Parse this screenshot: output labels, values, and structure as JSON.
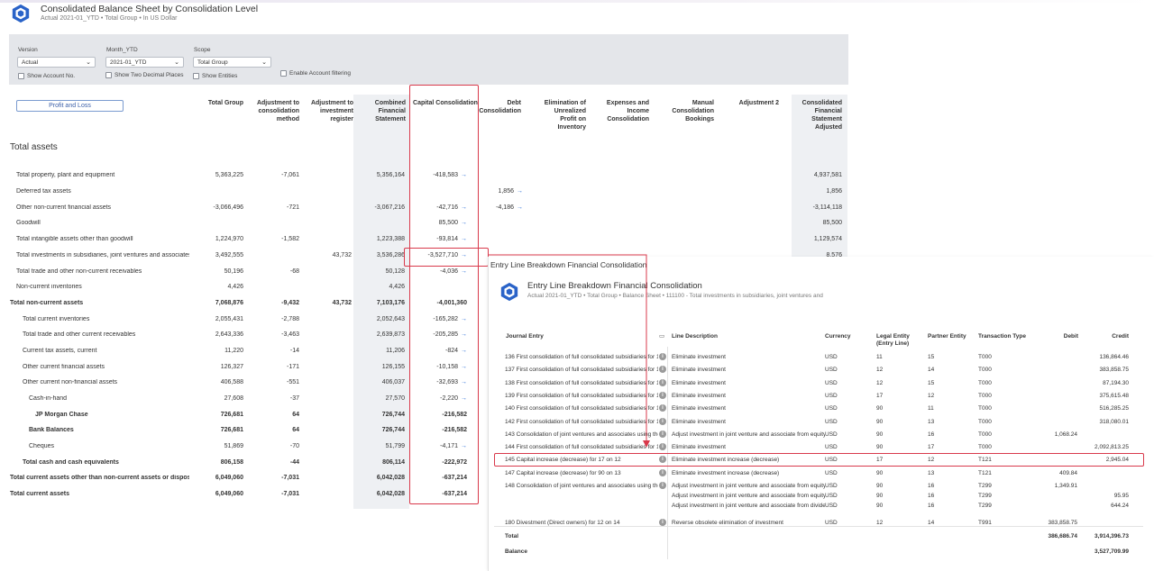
{
  "header": {
    "title": "Consolidated Balance Sheet by Consolidation Level",
    "subtitle": "Actual 2021-01_YTD • Total Group • In US Dollar"
  },
  "filters": {
    "version_label": "Version",
    "version_value": "Actual",
    "month_label": "Month_YTD",
    "month_value": "2021-01_YTD",
    "scope_label": "Scope",
    "scope_value": "Total Group",
    "show_account_no": "Show Account No.",
    "show_two_decimals": "Show Two Decimal Places",
    "show_entities": "Show Entities",
    "enable_account_filtering": "Enable Account filtering"
  },
  "pl_button": "Profit and Loss",
  "columns": [
    "Total Group",
    "Adjustment to consolidation method",
    "Adjustment to investment register",
    "Combined Financial Statement",
    "Capital Consolidation",
    "Debt Consolidation",
    "Elimination of Unrealized Profit on Inventory",
    "Expenses and Income Consolidation",
    "Manual Consolidation Bookings",
    "Adjustment 2",
    "Consolidated Financial Statement Adjusted"
  ],
  "section_title": "Total assets",
  "rows": [
    {
      "label": "Total property, plant and equipment",
      "indent": 0,
      "bold": false,
      "tg": "5,363,225",
      "acm": "-7,061",
      "air": "",
      "cfs": "5,356,164",
      "cc": "-418,583",
      "cc_arrow": true,
      "dc": "",
      "dc_arrow": false,
      "cfsa": "4,937,581"
    },
    {
      "label": "Deferred tax assets",
      "indent": 0,
      "bold": false,
      "tg": "",
      "acm": "",
      "air": "",
      "cfs": "",
      "cc": "",
      "cc_arrow": false,
      "dc": "1,856",
      "dc_arrow": true,
      "cfsa": "1,856"
    },
    {
      "label": "Other non-current financial assets",
      "indent": 0,
      "bold": false,
      "tg": "-3,066,496",
      "acm": "-721",
      "air": "",
      "cfs": "-3,067,216",
      "cc": "-42,716",
      "cc_arrow": true,
      "dc": "-4,186",
      "dc_arrow": true,
      "cfsa": "-3,114,118"
    },
    {
      "label": "Goodwill",
      "indent": 0,
      "bold": false,
      "tg": "",
      "acm": "",
      "air": "",
      "cfs": "",
      "cc": "85,500",
      "cc_arrow": true,
      "dc": "",
      "dc_arrow": false,
      "cfsa": "85,500"
    },
    {
      "label": "Total intangible assets other than goodwill",
      "indent": 0,
      "bold": false,
      "tg": "1,224,970",
      "acm": "-1,582",
      "air": "",
      "cfs": "1,223,388",
      "cc": "-93,814",
      "cc_arrow": true,
      "dc": "",
      "dc_arrow": false,
      "cfsa": "1,129,574"
    },
    {
      "label": "Total investments in subsidiaries, joint ventures and associates",
      "indent": 0,
      "bold": false,
      "tg": "3,492,555",
      "acm": "",
      "air": "43,732",
      "cfs": "3,536,286",
      "cc": "-3,527,710",
      "cc_arrow": true,
      "dc": "",
      "dc_arrow": false,
      "cfsa": "8,576"
    },
    {
      "label": "Total trade and other non-current receivables",
      "indent": 0,
      "bold": false,
      "tg": "50,196",
      "acm": "-68",
      "air": "",
      "cfs": "50,128",
      "cc": "-4,036",
      "cc_arrow": true,
      "dc": "",
      "dc_arrow": false,
      "cfsa": ""
    },
    {
      "label": "Non-current inventories",
      "indent": 0,
      "bold": false,
      "tg": "4,426",
      "acm": "",
      "air": "",
      "cfs": "4,426",
      "cc": "",
      "cc_arrow": false,
      "dc": "",
      "dc_arrow": false,
      "cfsa": ""
    },
    {
      "label": "Total non-current assets",
      "indent": -1,
      "bold": true,
      "tg": "7,068,876",
      "acm": "-9,432",
      "air": "43,732",
      "cfs": "7,103,176",
      "cc": "-4,001,360",
      "cc_arrow": false,
      "dc": "",
      "dc_arrow": false,
      "cfsa": ""
    },
    {
      "label": "Total current inventories",
      "indent": 1,
      "bold": false,
      "tg": "2,055,431",
      "acm": "-2,788",
      "air": "",
      "cfs": "2,052,643",
      "cc": "-165,282",
      "cc_arrow": true,
      "dc": "",
      "dc_arrow": false,
      "cfsa": ""
    },
    {
      "label": "Total trade and other current receivables",
      "indent": 1,
      "bold": false,
      "tg": "2,643,336",
      "acm": "-3,463",
      "air": "",
      "cfs": "2,639,873",
      "cc": "-205,285",
      "cc_arrow": true,
      "dc": "",
      "dc_arrow": false,
      "cfsa": ""
    },
    {
      "label": "Current tax assets, current",
      "indent": 1,
      "bold": false,
      "tg": "11,220",
      "acm": "-14",
      "air": "",
      "cfs": "11,206",
      "cc": "-824",
      "cc_arrow": true,
      "dc": "",
      "dc_arrow": false,
      "cfsa": ""
    },
    {
      "label": "Other current financial assets",
      "indent": 1,
      "bold": false,
      "tg": "126,327",
      "acm": "-171",
      "air": "",
      "cfs": "126,155",
      "cc": "-10,158",
      "cc_arrow": true,
      "dc": "",
      "dc_arrow": false,
      "cfsa": ""
    },
    {
      "label": "Other current non-financial assets",
      "indent": 1,
      "bold": false,
      "tg": "406,588",
      "acm": "-551",
      "air": "",
      "cfs": "406,037",
      "cc": "-32,693",
      "cc_arrow": true,
      "dc": "",
      "dc_arrow": false,
      "cfsa": ""
    },
    {
      "label": "Cash-in-hand",
      "indent": 2,
      "bold": false,
      "tg": "27,608",
      "acm": "-37",
      "air": "",
      "cfs": "27,570",
      "cc": "-2,220",
      "cc_arrow": true,
      "dc": "",
      "dc_arrow": false,
      "cfsa": ""
    },
    {
      "label": "JP Morgan Chase",
      "indent": 3,
      "bold": true,
      "tg": "726,681",
      "acm": "64",
      "air": "",
      "cfs": "726,744",
      "cc": "-216,582",
      "cc_arrow": false,
      "dc": "",
      "dc_arrow": false,
      "cfsa": ""
    },
    {
      "label": "Bank Balances",
      "indent": 2,
      "bold": true,
      "tg": "726,681",
      "acm": "64",
      "air": "",
      "cfs": "726,744",
      "cc": "-216,582",
      "cc_arrow": false,
      "dc": "",
      "dc_arrow": false,
      "cfsa": ""
    },
    {
      "label": "Cheques",
      "indent": 2,
      "bold": false,
      "tg": "51,869",
      "acm": "-70",
      "air": "",
      "cfs": "51,799",
      "cc": "-4,171",
      "cc_arrow": true,
      "dc": "",
      "dc_arrow": false,
      "cfsa": ""
    },
    {
      "label": "Total cash and cash equivalents",
      "indent": 1,
      "bold": true,
      "tg": "806,158",
      "acm": "-44",
      "air": "",
      "cfs": "806,114",
      "cc": "-222,972",
      "cc_arrow": false,
      "dc": "",
      "dc_arrow": false,
      "cfsa": ""
    },
    {
      "label": "Total current assets other than non-current assets or disposal groups",
      "indent": -1,
      "bold": true,
      "tg": "6,049,060",
      "acm": "-7,031",
      "air": "",
      "cfs": "6,042,028",
      "cc": "-637,214",
      "cc_arrow": false,
      "dc": "",
      "dc_arrow": false,
      "cfsa": ""
    },
    {
      "label": "Total current assets",
      "indent": -1,
      "bold": true,
      "tg": "6,049,060",
      "acm": "-7,031",
      "air": "",
      "cfs": "6,042,028",
      "cc": "-637,214",
      "cc_arrow": false,
      "dc": "",
      "dc_arrow": false,
      "cfsa": ""
    }
  ],
  "popup": {
    "label": "Entry Line Breakdown Financial Consolidation",
    "title": "Entry Line Breakdown Financial Consolidation",
    "subtitle": "Actual 2021-01_YTD • Total Group • Balance Sheet • 111100 - Total investments in subsidiaries, joint ventures and",
    "columns": {
      "journal": "Journal Entry",
      "line_desc": "Line Description",
      "currency": "Currency",
      "legal": "Legal Entity (Entry Line)",
      "partner": "Partner Entity",
      "ttype": "Transaction Type",
      "debit": "Debit",
      "credit": "Credit"
    },
    "rows": [
      {
        "je": "136 First consolidation of full consolidated subsidiaries for 15 on 11",
        "info": true,
        "lines": [
          {
            "desc": "Eliminate investment",
            "cur": "USD",
            "le": "11",
            "pe": "15",
            "tt": "T000",
            "debit": "",
            "credit": "136,864.46"
          }
        ]
      },
      {
        "je": "137 First consolidation of full consolidated subsidiaries for 14 on 12",
        "info": true,
        "lines": [
          {
            "desc": "Eliminate investment",
            "cur": "USD",
            "le": "12",
            "pe": "14",
            "tt": "T000",
            "debit": "",
            "credit": "383,858.75"
          }
        ]
      },
      {
        "je": "138 First consolidation of full consolidated subsidiaries for 15 on 12",
        "info": true,
        "lines": [
          {
            "desc": "Eliminate investment",
            "cur": "USD",
            "le": "12",
            "pe": "15",
            "tt": "T000",
            "debit": "",
            "credit": "87,194.30"
          }
        ]
      },
      {
        "je": "139 First consolidation of full consolidated subsidiaries for 12 on 17",
        "info": true,
        "lines": [
          {
            "desc": "Eliminate investment",
            "cur": "USD",
            "le": "17",
            "pe": "12",
            "tt": "T000",
            "debit": "",
            "credit": "375,615.48"
          }
        ]
      },
      {
        "je": "140 First consolidation of full consolidated subsidiaries for 11 on 90",
        "info": true,
        "lines": [
          {
            "desc": "Eliminate investment",
            "cur": "USD",
            "le": "90",
            "pe": "11",
            "tt": "T000",
            "debit": "",
            "credit": "516,285.25"
          }
        ]
      },
      {
        "je": "142 First consolidation of full consolidated subsidiaries for 13 on 90",
        "info": true,
        "lines": [
          {
            "desc": "Eliminate investment",
            "cur": "USD",
            "le": "90",
            "pe": "13",
            "tt": "T000",
            "debit": "",
            "credit": "318,080.01"
          }
        ]
      },
      {
        "je": "143 Consolidation of joint ventures and associates using the equity method",
        "info": true,
        "lines": [
          {
            "desc": "Adjust investment in joint venture and associate from equity",
            "cur": "USD",
            "le": "90",
            "pe": "16",
            "tt": "T000",
            "debit": "1,068.24",
            "credit": ""
          }
        ]
      },
      {
        "je": "144 First consolidation of full consolidated subsidiaries for 17 on 90",
        "info": true,
        "lines": [
          {
            "desc": "Eliminate investment",
            "cur": "USD",
            "le": "90",
            "pe": "17",
            "tt": "T000",
            "debit": "",
            "credit": "2,092,813.25"
          }
        ]
      },
      {
        "je": "145 Capital increase (decrease) for 17 on 12",
        "info": true,
        "lines": [
          {
            "desc": "Eliminate investment increase (decrease)",
            "cur": "USD",
            "le": "17",
            "pe": "12",
            "tt": "T121",
            "debit": "",
            "credit": "2,945.04"
          }
        ]
      },
      {
        "je": "147 Capital increase (decrease) for 90 on 13",
        "info": true,
        "lines": [
          {
            "desc": "Eliminate investment increase (decrease)",
            "cur": "USD",
            "le": "90",
            "pe": "13",
            "tt": "T121",
            "debit": "409.84",
            "credit": ""
          }
        ]
      },
      {
        "je": "148 Consolidation of joint ventures and associates using the equity method",
        "info": true,
        "lines": [
          {
            "desc": "Adjust investment in joint venture and associate from equity",
            "cur": "USD",
            "le": "90",
            "pe": "16",
            "tt": "T299",
            "debit": "1,349.91",
            "credit": ""
          },
          {
            "desc": "Adjust investment in joint venture and associate from equity",
            "cur": "USD",
            "le": "90",
            "pe": "16",
            "tt": "T299",
            "debit": "",
            "credit": "95.95"
          },
          {
            "desc": "Adjust investment in joint venture and associate from dividends",
            "cur": "USD",
            "le": "90",
            "pe": "16",
            "tt": "T299",
            "debit": "",
            "credit": "644.24"
          }
        ]
      },
      {
        "je": "180 Divestment (Direct owners) for 12 on 14",
        "info": true,
        "lines": [
          {
            "desc": "Reverse obsolete elimination of investment",
            "cur": "USD",
            "le": "12",
            "pe": "14",
            "tt": "T991",
            "debit": "383,858.75",
            "credit": ""
          }
        ]
      }
    ],
    "total_label": "Total",
    "total_debit": "386,686.74",
    "total_credit": "3,914,396.73",
    "balance_label": "Balance",
    "balance_credit": "3,527,709.99"
  },
  "colors": {
    "accent": "#2f6fd6",
    "highlight": "#d9394b",
    "filter_bg": "#e4e6ea",
    "logo_blue": "#2a63c8"
  },
  "icons": {
    "logo": "cube-logo-icon",
    "arrow": "arrow-right-icon",
    "info": "info-icon",
    "chevron": "chevron-down-icon"
  }
}
